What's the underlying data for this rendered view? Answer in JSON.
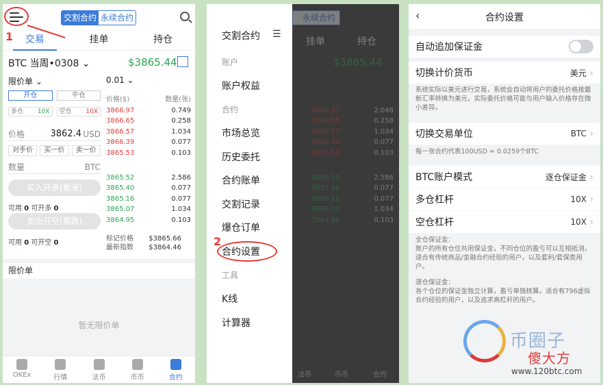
{
  "panel1": {
    "contract_tabs": [
      "交割合约",
      "永续合约"
    ],
    "tabs": [
      "交易",
      "挂单",
      "持仓"
    ],
    "annotation_number": "1",
    "ticker": "BTC 当周•0308 ⌄",
    "last_price": "$3865.44",
    "order_type": "限价单 ⌄",
    "qty_select": "0.01 ⌄",
    "open_label": "开仓",
    "close_label": "平仓",
    "long_lev_label": "多仓",
    "long_lev": "10X",
    "short_lev_label": "空仓",
    "short_lev": "10X",
    "price_label": "价格",
    "price_value": "3862.4",
    "price_unit": "USD",
    "quick_btns": [
      "对手价",
      "买一价",
      "卖一价"
    ],
    "amount_label": "数量",
    "amount_unit": "BTC",
    "buy_btn": "买入开多(看涨)",
    "sell_btn": "卖出开空(看跌)",
    "avail_buy": {
      "label1": "可用",
      "v1": "0",
      "label2": "可开多",
      "v2": "0"
    },
    "avail_sell": {
      "label1": "可用",
      "v1": "0",
      "label2": "可开空",
      "v2": "0"
    },
    "book_header": [
      "价格($)",
      "数量(张)"
    ],
    "asks": [
      [
        "3866.97",
        "0.749"
      ],
      [
        "3866.65",
        "0.258"
      ],
      [
        "3866.57",
        "1.034"
      ],
      [
        "3866.39",
        "0.077"
      ],
      [
        "3865.53",
        "0.103"
      ]
    ],
    "bids": [
      [
        "3865.52",
        "2.586"
      ],
      [
        "3865.40",
        "0.077"
      ],
      [
        "3865.16",
        "0.077"
      ],
      [
        "3865.07",
        "1.034"
      ],
      [
        "3864.95",
        "0.103"
      ]
    ],
    "mark_label": "标记价格",
    "mark_value": "$3865.66",
    "index_label": "最新指数",
    "index_value": "$3864.46",
    "limit_title": "限价单",
    "empty_text": "暂无限价单",
    "nav": [
      "OKEx",
      "行情",
      "法币",
      "币币",
      "合约"
    ]
  },
  "panel2": {
    "drawer_title": "交割合约",
    "close_glyph": "☰",
    "group_account": "账户",
    "item_equity": "账户权益",
    "group_contract": "合约",
    "items_contract": [
      "市场总览",
      "历史委托",
      "合约账单",
      "交割记录",
      "爆仓订单",
      "合约设置"
    ],
    "group_tools": "工具",
    "items_tools": [
      "K线",
      "计算器"
    ],
    "annotation_number": "2",
    "ghost_seg": "永续合约",
    "ghost_tabs": [
      "挂单",
      "持仓"
    ],
    "ghost_price": "$3865.44",
    "ghost_asks": [
      [
        "3866.97",
        "2.048"
      ],
      [
        "3866.65",
        "0.258"
      ],
      [
        "3866.57",
        "1.034"
      ],
      [
        "3866.39",
        "0.077"
      ],
      [
        "3865.53",
        "0.103"
      ]
    ],
    "ghost_bids": [
      [
        "3865.52",
        "2.586"
      ],
      [
        "3865.40",
        "0.077"
      ],
      [
        "3865.16",
        "0.077"
      ],
      [
        "3865.07",
        "1.034"
      ],
      [
        "3864.95",
        "0.103"
      ]
    ],
    "ghost_nav": [
      "法币",
      "币币",
      "合约"
    ]
  },
  "panel3": {
    "title": "合约设置",
    "back_glyph": "‹",
    "auto_margin_label": "自动追加保证金",
    "currency_label": "切换计价货币",
    "currency_value": "美元",
    "currency_note": "系统实际以美元进行交易，系统会自动将用户的委托价格按最新汇率转换为美元，实际委托价格可能与用户输入价格存在微小差异。",
    "unit_label": "切换交易单位",
    "unit_value": "BTC",
    "unit_note": "每一张合约代表100USD ≈ 0.0259个BTC",
    "mode_label": "BTC账户模式",
    "mode_value": "逐仓保证金",
    "long_lev_label": "多仓杠杆",
    "long_lev_value": "10X",
    "short_lev_label": "空仓杠杆",
    "short_lev_value": "10X",
    "cross_title": "全仓保证金：",
    "cross_desc": "账户的所有仓位共用保证金，不同仓位的盈亏可以互相抵消。适合有传统商品/金融合约经验的用户，以及套利/套保类用户。",
    "isolated_title": "逐仓保证金：",
    "isolated_desc": "各个仓位的保证金独立计算，盈亏单独核算。适合有796虚拟合约经验的用户，以及追求高杠杆的用户。",
    "watermark_a": "币",
    "watermark_b": "圈子",
    "watermark_c": "傻大方",
    "watermark_url": "www.120btc.com"
  },
  "colors": {
    "accent": "#3b7bd9",
    "up": "#2aa84f",
    "down": "#e53935",
    "annotation": "#e53935",
    "background": "#c9e2c4"
  }
}
